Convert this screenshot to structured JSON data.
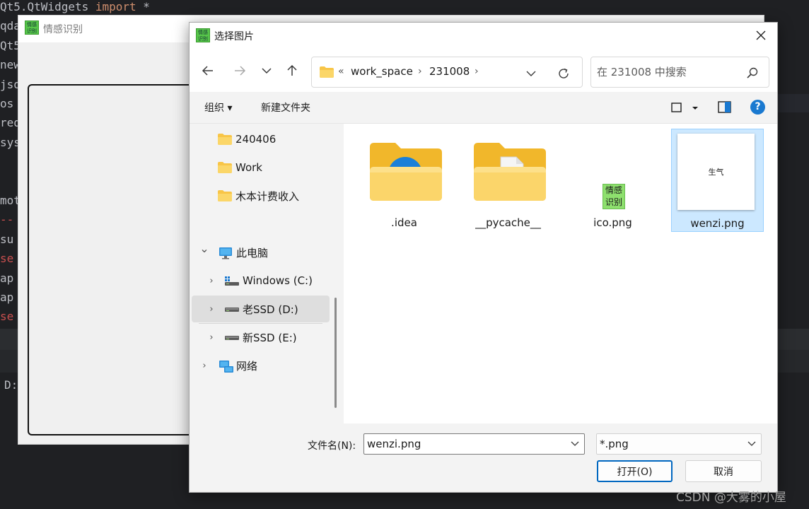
{
  "ide": {
    "code_lines": [
      {
        "pre": "Qt5.QtWidgets ",
        "kw": "import",
        "post": " *"
      },
      {
        "pre": "qda",
        "kw": "",
        "post": ""
      },
      {
        "pre": "Qt5",
        "kw": "",
        "post": ""
      },
      {
        "pre": "new",
        "kw": "",
        "post": ""
      },
      {
        "pre": "jso",
        "kw": "",
        "post": ""
      },
      {
        "pre": "os",
        "kw": "",
        "post": ""
      },
      {
        "pre": "req",
        "kw": "",
        "post": ""
      },
      {
        "pre": "sys",
        "kw": "",
        "post": ""
      },
      {
        "pre": "",
        "kw": "",
        "post": ""
      },
      {
        "pre": "",
        "kw": "",
        "post": ""
      },
      {
        "pre": "mot",
        "kw": "",
        "post": ""
      },
      {
        "pre": "",
        "kw": "",
        "post": "--",
        "red": true
      },
      {
        "pre": "su",
        "kw": "",
        "post": ""
      },
      {
        "pre": "",
        "kw": "",
        "post": "se",
        "red": true
      },
      {
        "pre": "ap",
        "kw": "",
        "post": ""
      },
      {
        "pre": "ap",
        "kw": "",
        "post": ""
      },
      {
        "pre": "",
        "kw": "",
        "post": "se",
        "red": true
      }
    ],
    "terminal_text": "D:"
  },
  "qt_window": {
    "title": "情感识别",
    "icon_text": "情感识别"
  },
  "dialog": {
    "title": "选择图片",
    "icon_text": "情感识别",
    "address": {
      "overflow": "«",
      "crumbs": [
        "work_space",
        "231008"
      ]
    },
    "search_placeholder": "在 231008 中搜索",
    "commands": {
      "organize": "组织 ▾",
      "new_folder": "新建文件夹"
    },
    "tree": [
      {
        "label": "240406",
        "icon": "folder-icon",
        "level": 1
      },
      {
        "label": "Work",
        "icon": "folder-icon",
        "level": 1
      },
      {
        "label": "木本计费收入",
        "icon": "folder-icon",
        "level": 1
      },
      {
        "label": "此电脑",
        "icon": "computer-icon",
        "level": 0,
        "expanded": true
      },
      {
        "label": "Windows (C:)",
        "icon": "drive-windows-icon",
        "level": 1
      },
      {
        "label": "老SSD (D:)",
        "icon": "drive-icon",
        "level": 1,
        "selected": true
      },
      {
        "label": "新SSD (E:)",
        "icon": "drive-icon",
        "level": 1
      },
      {
        "label": "网络",
        "icon": "network-icon",
        "level": 0
      }
    ],
    "files": [
      {
        "name": ".idea",
        "type": "folder-edge"
      },
      {
        "name": "__pycache__",
        "type": "folder-doc"
      },
      {
        "name": "ico.png",
        "type": "image-ico",
        "thumb_text": "情感识别"
      },
      {
        "name": "wenzi.png",
        "type": "image-white",
        "thumb_text": "生气",
        "selected": true
      }
    ],
    "bottom": {
      "filename_label": "文件名(N):",
      "filename_value": "wenzi.png",
      "filetype_value": "*.png",
      "open_label": "打开(O)",
      "cancel_label": "取消"
    }
  },
  "watermark": "CSDN @大雾的小屋",
  "colors": {
    "accent": "#0067c0",
    "selection": "#cce8ff",
    "folder": "#f8c547",
    "help": "#1a79d0"
  }
}
